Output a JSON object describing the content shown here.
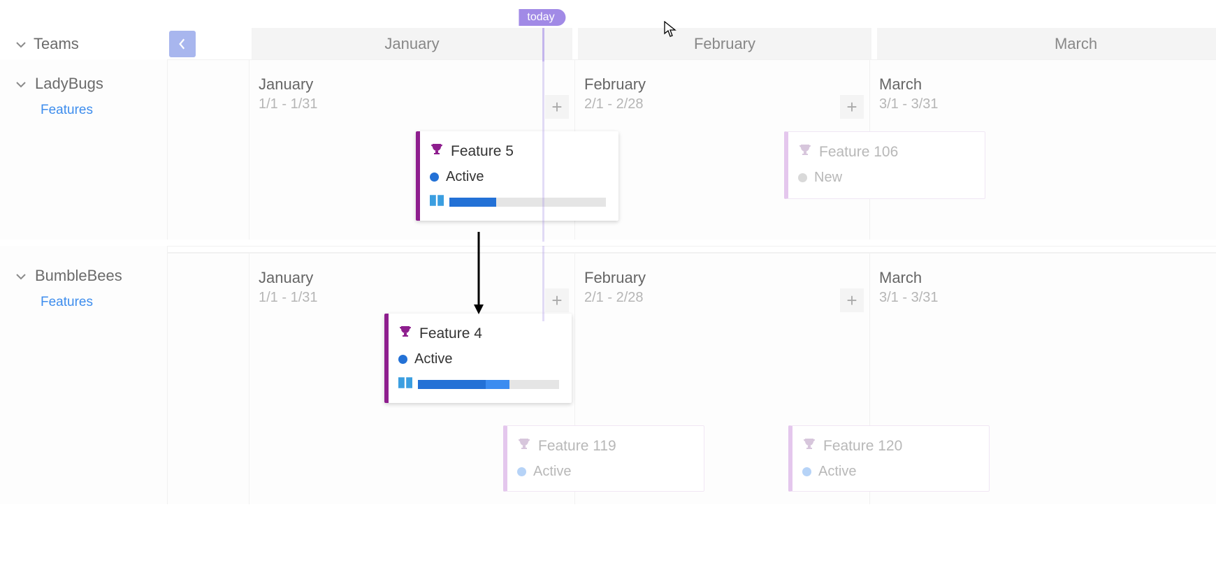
{
  "today_label": "today",
  "header": {
    "sidebar_label": "Teams",
    "months": {
      "jan": "January",
      "feb": "February",
      "mar": "March"
    }
  },
  "lanes": {
    "ladybugs": {
      "name": "LadyBugs",
      "sub": "Features",
      "months": {
        "jan": {
          "name": "January",
          "range": "1/1 - 1/31"
        },
        "feb": {
          "name": "February",
          "range": "2/1 - 2/28"
        },
        "mar": {
          "name": "March",
          "range": "3/1 - 3/31"
        }
      },
      "cards": {
        "feature5": {
          "title": "Feature 5",
          "status": "Active",
          "progress": 0.3
        },
        "feature106": {
          "title": "Feature 106",
          "status": "New"
        }
      }
    },
    "bumble": {
      "name": "BumbleBees",
      "sub": "Features",
      "months": {
        "jan": {
          "name": "January",
          "range": "1/1 - 1/31"
        },
        "feb": {
          "name": "February",
          "range": "2/1 - 2/28"
        },
        "mar": {
          "name": "March",
          "range": "3/1 - 3/31"
        }
      },
      "cards": {
        "feature4": {
          "title": "Feature 4",
          "status": "Active",
          "progress": 0.6
        },
        "feature119": {
          "title": "Feature 119",
          "status": "Active"
        },
        "feature120": {
          "title": "Feature 120",
          "status": "Active"
        }
      }
    }
  }
}
